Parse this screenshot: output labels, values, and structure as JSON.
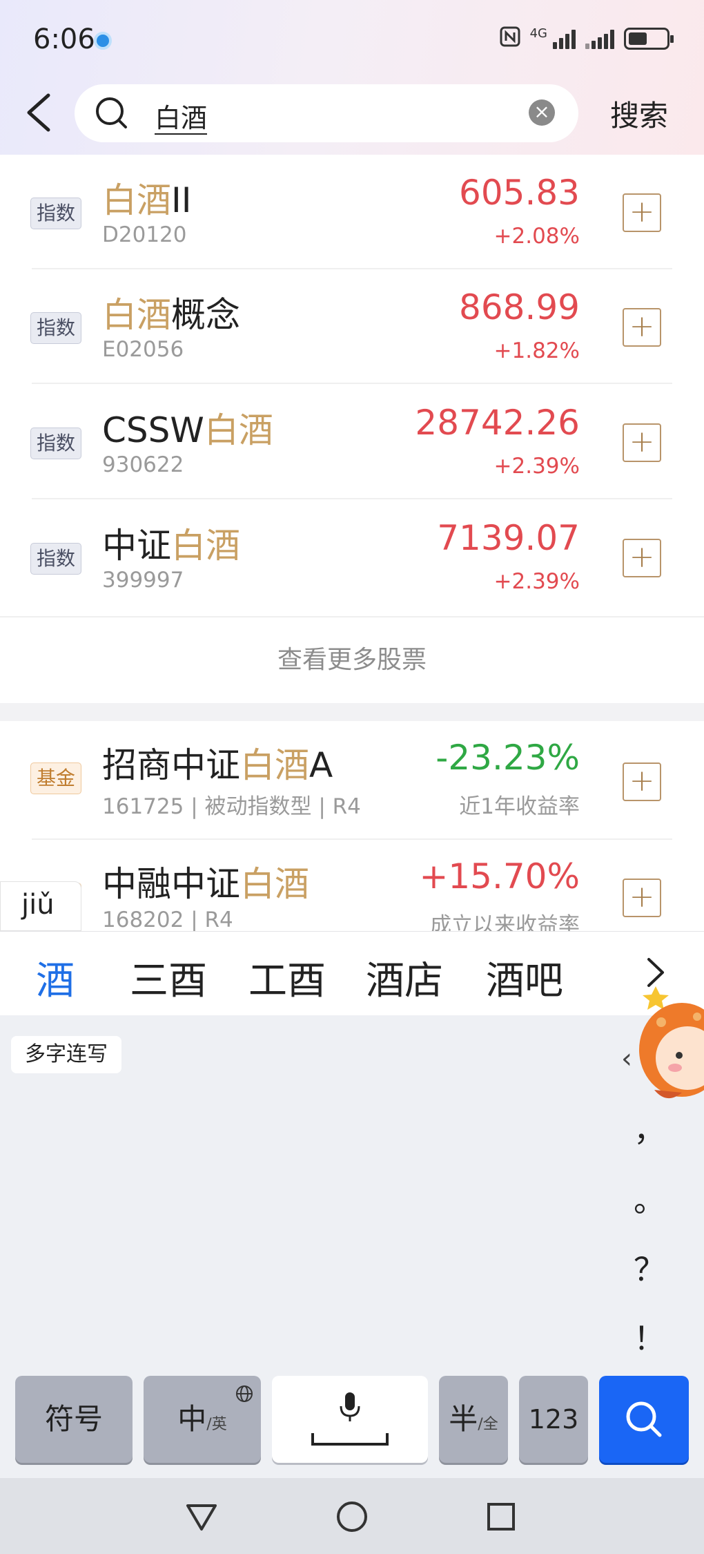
{
  "status_bar": {
    "time": "6:06",
    "network_label": "4G"
  },
  "search": {
    "query": "白酒",
    "action_label": "搜索"
  },
  "index_results": [
    {
      "tag": "指数",
      "name_highlight": "白酒",
      "name_suffix": "II",
      "name_prefix": "",
      "code": "D20120",
      "price": "605.83",
      "change": "+2.08%",
      "trend": "up"
    },
    {
      "tag": "指数",
      "name_highlight": "白酒",
      "name_suffix": "概念",
      "name_prefix": "",
      "code": "E02056",
      "price": "868.99",
      "change": "+1.82%",
      "trend": "up"
    },
    {
      "tag": "指数",
      "name_prefix": "CSSW",
      "name_highlight": "白酒",
      "name_suffix": "",
      "code": "930622",
      "price": "28742.26",
      "change": "+2.39%",
      "trend": "up"
    },
    {
      "tag": "指数",
      "name_prefix": "中证",
      "name_highlight": "白酒",
      "name_suffix": "",
      "code": "399997",
      "price": "7139.07",
      "change": "+2.39%",
      "trend": "up"
    }
  ],
  "more_stocks_label": "查看更多股票",
  "fund_results": [
    {
      "tag": "基金",
      "name_prefix": "招商中证",
      "name_highlight": "白酒",
      "name_suffix": "A",
      "code": "161725 | 被动指数型 | R4",
      "return": "-23.23%",
      "return_label": "近1年收益率",
      "trend": "down"
    },
    {
      "tag": "基金",
      "name_prefix": "中融中证",
      "name_highlight": "白酒",
      "name_suffix": "",
      "code": "168202 | R4",
      "return": "+15.70%",
      "return_label": "成立以来收益率",
      "trend": "up"
    }
  ],
  "keyboard": {
    "pinyin": "jiǔ",
    "candidates": [
      "酒",
      "三酉",
      "工酉",
      "酒店",
      "酒吧"
    ],
    "multi_char_label": "多字连写",
    "punctuation": [
      "，",
      "。",
      "？",
      "！"
    ],
    "keys": {
      "symbol": "符号",
      "lang_main": "中",
      "lang_sub": "/英",
      "half_main": "半",
      "half_sub": "/全",
      "numeric": "123"
    }
  },
  "colors": {
    "highlight": "#c9a063",
    "up": "#e24a50",
    "down": "#2fa844",
    "accent_blue": "#1a66f5"
  }
}
